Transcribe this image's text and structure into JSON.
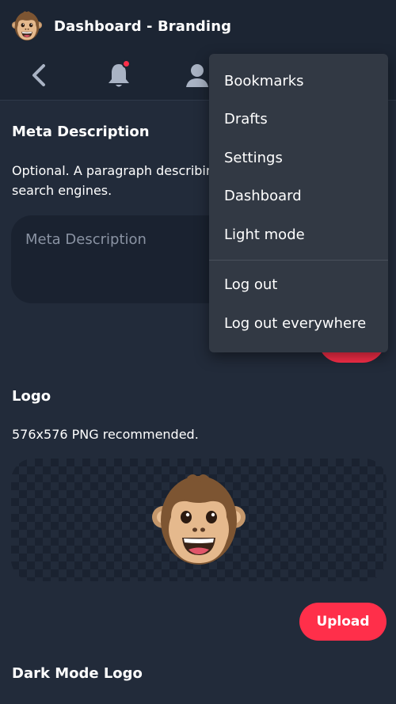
{
  "header": {
    "title": "Dashboard - Branding",
    "notification_color": "#ff2f4a"
  },
  "nav": {
    "icons": [
      "chevron-left-icon",
      "bell-icon",
      "user-icon"
    ]
  },
  "meta": {
    "heading": "Meta Description",
    "description_line1": "Optional. A paragraph describin",
    "description_line2": "search engines.",
    "placeholder": "Meta Description"
  },
  "logo": {
    "heading": "Logo",
    "note": "576x576 PNG recommended.",
    "upload_label": "Upload"
  },
  "dark_logo": {
    "heading": "Dark Mode Logo"
  },
  "menu": {
    "items": [
      "Bookmarks",
      "Drafts",
      "Settings",
      "Dashboard",
      "Light mode"
    ],
    "items_secondary": [
      "Log out",
      "Log out everywhere"
    ]
  },
  "colors": {
    "accent": "#ff2f4a",
    "background": "#222b3a",
    "header": "#1c2533",
    "menu": "#323944"
  }
}
